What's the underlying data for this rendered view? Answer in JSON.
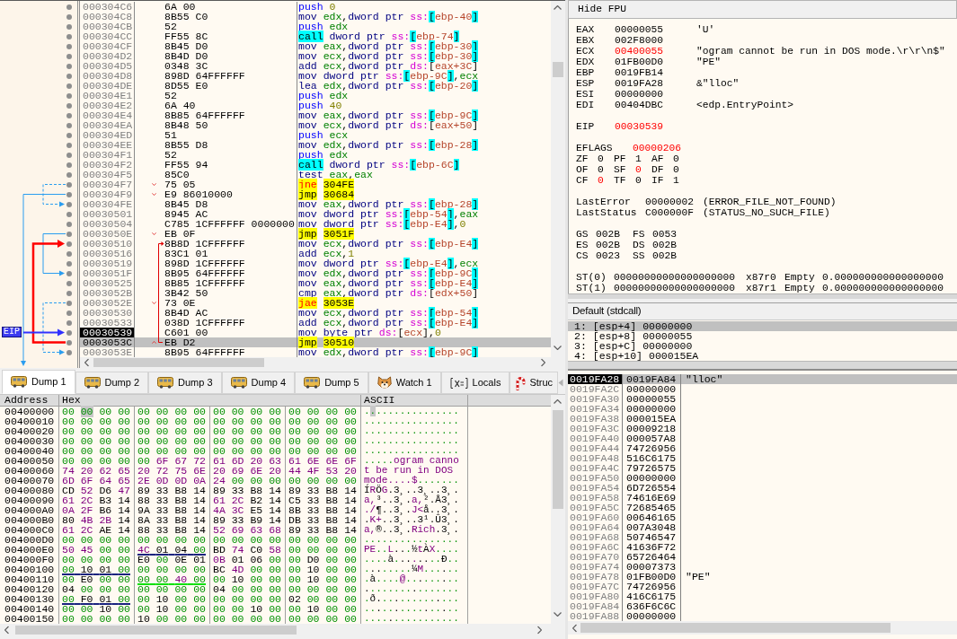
{
  "disassembly": {
    "eip_label": "EIP",
    "rows": [
      {
        "address": "000304C6",
        "bytes": "6A 00",
        "mnemonic": "push",
        "operands": "0",
        "kind": "push",
        "selected": false,
        "current": false
      },
      {
        "address": "000304C8",
        "bytes": "8B55 C0",
        "mnemonic": "mov",
        "operands": "edx,dword ptr ss:[ebp-40]",
        "kind": "plain",
        "stack_ref": true,
        "selected": false,
        "current": false
      },
      {
        "address": "000304CB",
        "bytes": "52",
        "mnemonic": "push",
        "operands": "edx",
        "kind": "push",
        "selected": false,
        "current": false
      },
      {
        "address": "000304CC",
        "bytes": "FF55 8C",
        "mnemonic": "call",
        "operands": "dword ptr ss:[ebp-74]",
        "kind": "call",
        "stack_ref": true,
        "selected": false,
        "current": false
      },
      {
        "address": "000304CF",
        "bytes": "8B45 D0",
        "mnemonic": "mov",
        "operands": "eax,dword ptr ss:[ebp-30]",
        "kind": "plain",
        "stack_ref": true,
        "selected": false,
        "current": false
      },
      {
        "address": "000304D2",
        "bytes": "8B4D D0",
        "mnemonic": "mov",
        "operands": "ecx,dword ptr ss:[ebp-30]",
        "kind": "plain",
        "stack_ref": true,
        "selected": false,
        "current": false
      },
      {
        "address": "000304D5",
        "bytes": "0348 3C",
        "mnemonic": "add",
        "operands": "ecx,dword ptr ds:[eax+3C]",
        "kind": "plain",
        "stack_ref": false,
        "selected": false,
        "current": false
      },
      {
        "address": "000304D8",
        "bytes": "898D 64FFFFFF",
        "mnemonic": "mov",
        "operands": "dword ptr ss:[ebp-9C],ecx",
        "kind": "plain",
        "stack_ref": true,
        "selected": false,
        "current": false
      },
      {
        "address": "000304DE",
        "bytes": "8D55 E0",
        "mnemonic": "lea",
        "operands": "edx,dword ptr ss:[ebp-20]",
        "kind": "plain",
        "stack_ref": true,
        "selected": false,
        "current": false
      },
      {
        "address": "000304E1",
        "bytes": "52",
        "mnemonic": "push",
        "operands": "edx",
        "kind": "push",
        "selected": false,
        "current": false
      },
      {
        "address": "000304E2",
        "bytes": "6A 40",
        "mnemonic": "push",
        "operands": "40",
        "kind": "push",
        "selected": false,
        "current": false
      },
      {
        "address": "000304E4",
        "bytes": "8B85 64FFFFFF",
        "mnemonic": "mov",
        "operands": "eax,dword ptr ss:[ebp-9C]",
        "kind": "plain",
        "stack_ref": true,
        "selected": false,
        "current": false
      },
      {
        "address": "000304EA",
        "bytes": "8B48 50",
        "mnemonic": "mov",
        "operands": "ecx,dword ptr ds:[eax+50]",
        "kind": "plain",
        "stack_ref": false,
        "selected": false,
        "current": false
      },
      {
        "address": "000304ED",
        "bytes": "51",
        "mnemonic": "push",
        "operands": "ecx",
        "kind": "push",
        "selected": false,
        "current": false
      },
      {
        "address": "000304EE",
        "bytes": "8B55 D8",
        "mnemonic": "mov",
        "operands": "edx,dword ptr ss:[ebp-28]",
        "kind": "plain",
        "stack_ref": true,
        "selected": false,
        "current": false
      },
      {
        "address": "000304F1",
        "bytes": "52",
        "mnemonic": "push",
        "operands": "edx",
        "kind": "push",
        "selected": false,
        "current": false
      },
      {
        "address": "000304F2",
        "bytes": "FF55 94",
        "mnemonic": "call",
        "operands": "dword ptr ss:[ebp-6C]",
        "kind": "call",
        "stack_ref": true,
        "selected": false,
        "current": false
      },
      {
        "address": "000304F5",
        "bytes": "85C0",
        "mnemonic": "test",
        "operands": "eax,eax",
        "kind": "plain",
        "selected": false,
        "current": false
      },
      {
        "address": "000304F7",
        "bytes": "75 05",
        "mnemonic": "jne",
        "operands": "304FE",
        "kind": "cond_jump",
        "selected": false,
        "current": false,
        "marker": {
          "kind": "down"
        }
      },
      {
        "address": "000304F9",
        "bytes": "E9 86010000",
        "mnemonic": "jmp",
        "operands": "30684",
        "kind": "jump",
        "selected": false,
        "current": false,
        "marker": {
          "kind": "down"
        }
      },
      {
        "address": "000304FE",
        "bytes": "8B45 D8",
        "mnemonic": "mov",
        "operands": "eax,dword ptr ss:[ebp-28]",
        "kind": "plain",
        "stack_ref": true,
        "selected": false,
        "current": false
      },
      {
        "address": "00030501",
        "bytes": "8945 AC",
        "mnemonic": "mov",
        "operands": "dword ptr ss:[ebp-54],eax",
        "kind": "plain",
        "stack_ref": true,
        "selected": false,
        "current": false
      },
      {
        "address": "00030504",
        "bytes": "C785 1CFFFFFF 0000000",
        "mnemonic": "mov",
        "operands": "dword ptr ss:[ebp-E4],0",
        "kind": "plain",
        "stack_ref": true,
        "selected": false,
        "current": false
      },
      {
        "address": "0003050E",
        "bytes": "EB 0F",
        "mnemonic": "jmp",
        "operands": "3051F",
        "kind": "jump",
        "selected": false,
        "current": false,
        "marker": {
          "kind": "down"
        }
      },
      {
        "address": "00030510",
        "bytes": "8B8D 1CFFFFFF",
        "mnemonic": "mov",
        "operands": "ecx,dword ptr ss:[ebp-E4]",
        "kind": "plain",
        "stack_ref": true,
        "selected": false,
        "current": false
      },
      {
        "address": "00030516",
        "bytes": "83C1 01",
        "mnemonic": "add",
        "operands": "ecx,1",
        "kind": "plain",
        "selected": false,
        "current": false
      },
      {
        "address": "00030519",
        "bytes": "898D 1CFFFFFF",
        "mnemonic": "mov",
        "operands": "dword ptr ss:[ebp-E4],ecx",
        "kind": "plain",
        "stack_ref": true,
        "selected": false,
        "current": false
      },
      {
        "address": "0003051F",
        "bytes": "8B95 64FFFFFF",
        "mnemonic": "mov",
        "operands": "edx,dword ptr ss:[ebp-9C]",
        "kind": "plain",
        "stack_ref": true,
        "selected": false,
        "current": false
      },
      {
        "address": "00030525",
        "bytes": "8B85 1CFFFFFF",
        "mnemonic": "mov",
        "operands": "eax,dword ptr ss:[ebp-E4]",
        "kind": "plain",
        "stack_ref": true,
        "selected": false,
        "current": false
      },
      {
        "address": "0003052B",
        "bytes": "3B42 50",
        "mnemonic": "cmp",
        "operands": "eax,dword ptr ds:[edx+50]",
        "kind": "plain",
        "stack_ref": false,
        "selected": false,
        "current": false
      },
      {
        "address": "0003052E",
        "bytes": "73 0E",
        "mnemonic": "jae",
        "operands": "3053E",
        "kind": "cond_jump",
        "selected": false,
        "current": false,
        "marker": {
          "kind": "down"
        }
      },
      {
        "address": "00030530",
        "bytes": "8B4D AC",
        "mnemonic": "mov",
        "operands": "ecx,dword ptr ss:[ebp-54]",
        "kind": "plain",
        "stack_ref": true,
        "selected": false,
        "current": false
      },
      {
        "address": "00030533",
        "bytes": "038D 1CFFFFFF",
        "mnemonic": "add",
        "operands": "ecx,dword ptr ss:[ebp-E4]",
        "kind": "plain",
        "stack_ref": true,
        "selected": false,
        "current": false
      },
      {
        "address": "00030539",
        "bytes": "C601 00",
        "mnemonic": "mov",
        "operands": "byte ptr ds:[ecx],0",
        "kind": "plain",
        "stack_ref": false,
        "selected": false,
        "current": true
      },
      {
        "address": "0003053C",
        "bytes": "EB D2",
        "mnemonic": "jmp",
        "operands": "30510",
        "kind": "jump",
        "selected": true,
        "current": false,
        "marker": {
          "kind": "up"
        }
      },
      {
        "address": "0003053E",
        "bytes": "8B95 64FFFFFF",
        "mnemonic": "mov",
        "operands": "edx,dword ptr ss:[ebp-9C]",
        "kind": "plain",
        "stack_ref": true,
        "selected": false,
        "current": false
      }
    ]
  },
  "registers": {
    "hide_fpu_button": "Hide FPU",
    "general": [
      {
        "name": "EAX",
        "value": "00000055",
        "changed": false,
        "comment": "'U'"
      },
      {
        "name": "EBX",
        "value": "002F8000",
        "changed": false
      },
      {
        "name": "ECX",
        "value": "00400055",
        "changed": true,
        "comment": "\"ogram cannot be run in DOS mode.\\r\\r\\n$\""
      },
      {
        "name": "EDX",
        "value": "01FB00D0",
        "changed": false,
        "comment": "\"PE\""
      },
      {
        "name": "EBP",
        "value": "0019FB14",
        "changed": false
      },
      {
        "name": "ESP",
        "value": "0019FA28",
        "changed": false,
        "comment": "&\"lloc\""
      },
      {
        "name": "ESI",
        "value": "00000000",
        "changed": false
      },
      {
        "name": "EDI",
        "value": "00404DBC",
        "changed": false,
        "comment": "<edp.EntryPoint>"
      }
    ],
    "eip": {
      "name": "EIP",
      "value": "00030539",
      "changed": true
    },
    "eflags": {
      "name": "EFLAGS",
      "value": "00000206",
      "changed": true
    },
    "flags": [
      {
        "name": "ZF",
        "value": "0",
        "changed": false
      },
      {
        "name": "PF",
        "value": "1",
        "changed": false
      },
      {
        "name": "AF",
        "value": "0",
        "changed": false
      },
      {
        "name": "OF",
        "value": "0",
        "changed": false
      },
      {
        "name": "SF",
        "value": "0",
        "changed": true
      },
      {
        "name": "DF",
        "value": "0",
        "changed": false
      },
      {
        "name": "CF",
        "value": "0",
        "changed": true
      },
      {
        "name": "TF",
        "value": "0",
        "changed": false
      },
      {
        "name": "IF",
        "value": "1",
        "changed": false
      }
    ],
    "last_error": {
      "name": "LastError",
      "value": "00000002",
      "comment": "(ERROR_FILE_NOT_FOUND)"
    },
    "last_status": {
      "name": "LastStatus",
      "value": "C000000F",
      "comment": "(STATUS_NO_SUCH_FILE)"
    },
    "segments": [
      {
        "name": "GS",
        "value": "002B"
      },
      {
        "name": "FS",
        "value": "0053"
      },
      {
        "name": "ES",
        "value": "002B"
      },
      {
        "name": "DS",
        "value": "002B"
      },
      {
        "name": "CS",
        "value": "0023"
      },
      {
        "name": "SS",
        "value": "002B"
      }
    ],
    "fpu": [
      {
        "name": "ST(0)",
        "value": "00000000000000000000",
        "tag": "x87r0",
        "state": "Empty",
        "float": "0.000000000000000000"
      },
      {
        "name": "ST(1)",
        "value": "00000000000000000000",
        "tag": "x87r1",
        "state": "Empty",
        "float": "0.000000000000000000"
      }
    ]
  },
  "call_convention": {
    "title": "Default (stdcall)",
    "args": [
      {
        "index": "1:",
        "location": "[esp+4]",
        "value": "00000000",
        "selected": true
      },
      {
        "index": "2:",
        "location": "[esp+8]",
        "value": "00000055",
        "selected": false
      },
      {
        "index": "3:",
        "location": "[esp+C]",
        "value": "00000000",
        "selected": false
      },
      {
        "index": "4:",
        "location": "[esp+10]",
        "value": "000015EA",
        "selected": false
      }
    ]
  },
  "dump": {
    "tabs": [
      {
        "label": "Dump 1",
        "kind": "dump",
        "selected": true
      },
      {
        "label": "Dump 2",
        "kind": "dump",
        "selected": false
      },
      {
        "label": "Dump 3",
        "kind": "dump",
        "selected": false
      },
      {
        "label": "Dump 4",
        "kind": "dump",
        "selected": false
      },
      {
        "label": "Dump 5",
        "kind": "dump",
        "selected": false
      },
      {
        "label": "Watch 1",
        "kind": "watch",
        "selected": false
      },
      {
        "label": "Locals",
        "kind": "locals",
        "selected": false
      },
      {
        "label": "Struc",
        "kind": "struct",
        "selected": false
      }
    ],
    "columns": [
      "Address",
      "Hex",
      "ASCII"
    ],
    "rows": [
      {
        "address": "00400000",
        "hex": [
          "00 00 00 00",
          "00 00 00 00",
          "00 00 00 00",
          "00 00 00 00"
        ],
        "ascii": "................",
        "cursor": [
          false,
          true,
          false,
          false,
          false,
          false,
          false,
          false,
          false,
          false,
          false,
          false,
          false,
          false,
          false,
          false
        ]
      },
      {
        "address": "00400010",
        "hex": [
          "00 00 00 00",
          "00 00 00 00",
          "00 00 00 00",
          "00 00 00 00"
        ],
        "ascii": "................"
      },
      {
        "address": "00400020",
        "hex": [
          "00 00 00 00",
          "00 00 00 00",
          "00 00 00 00",
          "00 00 00 00"
        ],
        "ascii": "................"
      },
      {
        "address": "00400030",
        "hex": [
          "00 00 00 00",
          "00 00 00 00",
          "00 00 00 00",
          "00 00 00 00"
        ],
        "ascii": "................"
      },
      {
        "address": "00400040",
        "hex": [
          "00 00 00 00",
          "00 00 00 00",
          "00 00 00 00",
          "00 00 00 00"
        ],
        "ascii": "................"
      },
      {
        "address": "00400050",
        "hex": [
          "00 00 00 00",
          "00 6F 67 72",
          "61 6D 20 63",
          "61 6E 6E 6F"
        ],
        "ascii": ".....ogram canno"
      },
      {
        "address": "00400060",
        "hex": [
          "74 20 62 65",
          "20 72 75 6E",
          "20 69 6E 20",
          "44 4F 53 20"
        ],
        "ascii": "t be run in DOS "
      },
      {
        "address": "00400070",
        "hex": [
          "6D 6F 64 65",
          "2E 0D 0D 0A",
          "24 00 00 00",
          "00 00 00 00"
        ],
        "ascii": "mode....$......."
      },
      {
        "address": "00400080",
        "hex": [
          "CD 52 D6 47",
          "89 33 B8 14",
          "89 33 B8 14",
          "89 33 B8 14"
        ],
        "ascii": "ÍRÖG.3¸..3¸..3¸."
      },
      {
        "address": "00400090",
        "hex": [
          "61 2C B3 14",
          "88 33 B8 14",
          "61 2C B2 14",
          "C5 33 B8 14"
        ],
        "ascii": "a,³..3¸.a,².Å3¸."
      },
      {
        "address": "004000A0",
        "hex": [
          "0A 2F B6 14",
          "9A 33 B8 14",
          "4A 3C E5 14",
          "8B 33 B8 14"
        ],
        "ascii": "./¶..3¸.J<å..3¸."
      },
      {
        "address": "004000B0",
        "hex": [
          "80 4B 2B 14",
          "8A 33 B8 14",
          "89 33 B9 14",
          "DB 33 B8 14"
        ],
        "ascii": ".K+..3¸..3¹.Û3¸."
      },
      {
        "address": "004000C0",
        "hex": [
          "61 2C AE 14",
          "88 33 B8 14",
          "52 69 63 68",
          "89 33 B8 14"
        ],
        "ascii": "a,®..3¸.Rich.3¸."
      },
      {
        "address": "004000D0",
        "hex": [
          "00 00 00 00",
          "00 00 00 00",
          "00 00 00 00",
          "00 00 00 00"
        ],
        "ascii": "................"
      },
      {
        "address": "004000E0",
        "hex": [
          "50 45 00 00",
          "4C 01 04 00",
          "BD 74 C0 58",
          "00 00 00 00"
        ],
        "ascii": "PE..L...½tÀX....",
        "underlined": [
          false,
          true,
          false,
          false
        ],
        "color": "#1a237e"
      },
      {
        "address": "004000F0",
        "hex": [
          "00 00 00 00",
          "E0 00 0E 01",
          "0B 01 06 00",
          "00 D0 00 00"
        ],
        "ascii": "....à........Ð.."
      },
      {
        "address": "00400100",
        "hex": [
          "00 10 01 00",
          "00 00 00 00",
          "BC 4D 00 00",
          "00 10 00 00"
        ],
        "ascii": "........¼M......",
        "underlined": [
          true,
          false,
          false,
          false
        ],
        "color": "#1a237e"
      },
      {
        "address": "00400110",
        "hex": [
          "00 E0 00 00",
          "00 00 40 00",
          "00 10 00 00",
          "00 10 00 00"
        ],
        "ascii": ".à....@.........",
        "underlined": [
          false,
          true,
          false,
          false
        ],
        "color": "#00e000"
      },
      {
        "address": "00400120",
        "hex": [
          "04 00 00 00",
          "00 00 00 00",
          "04 00 00 00",
          "00 00 00 00"
        ],
        "ascii": "................"
      },
      {
        "address": "00400130",
        "hex": [
          "00 F0 01 00",
          "00 10 00 00",
          "00 00 00 00",
          "02 00 00 00"
        ],
        "ascii": ".ð..............",
        "underlined": [
          true,
          false,
          false,
          false
        ],
        "color": "#1a237e"
      },
      {
        "address": "00400140",
        "hex": [
          "00 00 10 00",
          "00 10 00 00",
          "00 00 10 00",
          "00 10 00 00"
        ],
        "ascii": "................"
      },
      {
        "address": "00400150",
        "hex": [
          "00 00 00 00",
          "10 00 00 00",
          "00 00 00 00",
          "00 00 00 00"
        ],
        "ascii": "................"
      }
    ]
  },
  "stack": {
    "rows": [
      {
        "address": "0019FA28",
        "value": "0019FA84",
        "comment": "\"lloc\"",
        "current": true,
        "selected": true
      },
      {
        "address": "0019FA2C",
        "value": "00000000",
        "current": false,
        "selected": false
      },
      {
        "address": "0019FA30",
        "value": "00000055",
        "current": false,
        "selected": false
      },
      {
        "address": "0019FA34",
        "value": "00000000",
        "current": false,
        "selected": false
      },
      {
        "address": "0019FA38",
        "value": "000015EA",
        "current": false,
        "selected": false
      },
      {
        "address": "0019FA3C",
        "value": "00009218",
        "current": false,
        "selected": false
      },
      {
        "address": "0019FA40",
        "value": "000057A8",
        "current": false,
        "selected": false
      },
      {
        "address": "0019FA44",
        "value": "74726956",
        "current": false,
        "selected": false
      },
      {
        "address": "0019FA48",
        "value": "516C6175",
        "current": false,
        "selected": false
      },
      {
        "address": "0019FA4C",
        "value": "79726575",
        "current": false,
        "selected": false
      },
      {
        "address": "0019FA50",
        "value": "00000000",
        "current": false,
        "selected": false
      },
      {
        "address": "0019FA54",
        "value": "6D726554",
        "current": false,
        "selected": false
      },
      {
        "address": "0019FA58",
        "value": "74616E69",
        "current": false,
        "selected": false
      },
      {
        "address": "0019FA5C",
        "value": "72685465",
        "current": false,
        "selected": false
      },
      {
        "address": "0019FA60",
        "value": "00646165",
        "current": false,
        "selected": false
      },
      {
        "address": "0019FA64",
        "value": "007A3048",
        "current": false,
        "selected": false
      },
      {
        "address": "0019FA68",
        "value": "50746547",
        "current": false,
        "selected": false
      },
      {
        "address": "0019FA6C",
        "value": "41636F72",
        "current": false,
        "selected": false
      },
      {
        "address": "0019FA70",
        "value": "65726464",
        "current": false,
        "selected": false
      },
      {
        "address": "0019FA74",
        "value": "00007373",
        "current": false,
        "selected": false
      },
      {
        "address": "0019FA78",
        "value": "01FB00D0",
        "comment": "\"PE\"",
        "current": false,
        "selected": false
      },
      {
        "address": "0019FA7C",
        "value": "74726956",
        "current": false,
        "selected": false
      },
      {
        "address": "0019FA80",
        "value": "416C6175",
        "current": false,
        "selected": false
      },
      {
        "address": "0019FA84",
        "value": "636F6C6C",
        "current": false,
        "selected": false
      },
      {
        "address": "0019FA88",
        "value": "00000000",
        "current": false,
        "selected": false
      }
    ]
  }
}
